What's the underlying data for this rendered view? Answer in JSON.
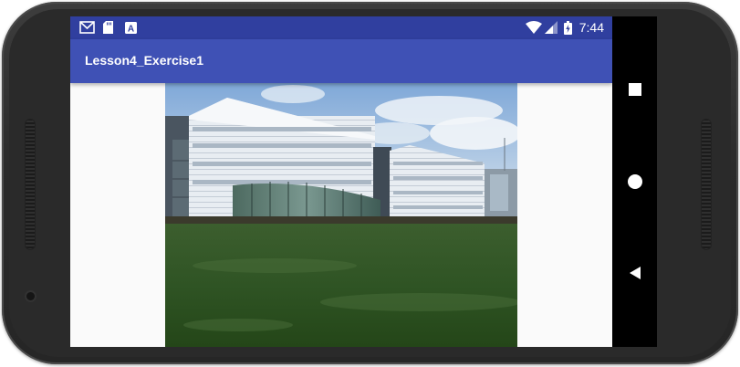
{
  "status_bar": {
    "time": "7:44",
    "left_icons": [
      "gmail-icon",
      "sd-card-icon",
      "a-notification-icon"
    ],
    "right_icons": [
      "wifi-icon",
      "cell-signal-icon",
      "battery-charging-icon"
    ],
    "a_icon_letter": "A"
  },
  "action_bar": {
    "title": "Lesson4_Exercise1"
  },
  "image": {
    "subject": "building-photo"
  },
  "nav_bar": {
    "buttons": [
      "overview-button",
      "home-button",
      "back-button"
    ]
  },
  "colors": {
    "status_bar": "#303f9f",
    "action_bar": "#3f51b5",
    "background": "#fafafa"
  }
}
